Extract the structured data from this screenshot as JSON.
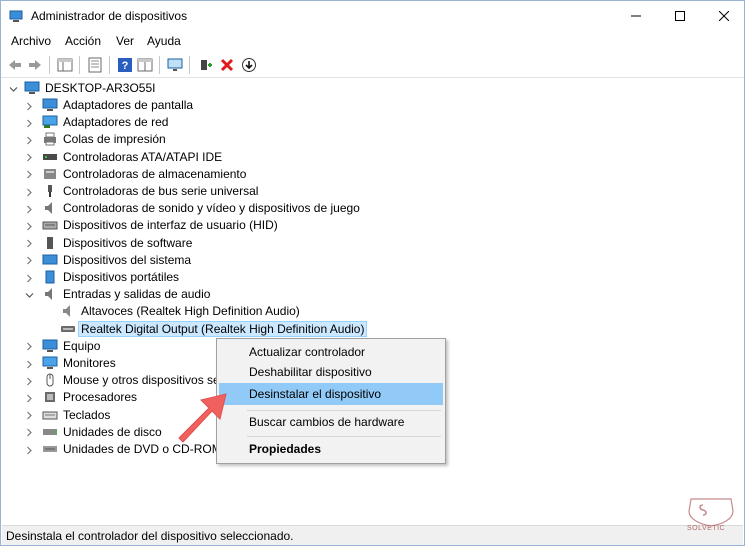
{
  "window": {
    "title": "Administrador de dispositivos"
  },
  "menu": [
    "Archivo",
    "Acción",
    "Ver",
    "Ayuda"
  ],
  "tree": {
    "root": "DESKTOP-AR3O55I",
    "items": [
      "Adaptadores de pantalla",
      "Adaptadores de red",
      "Colas de impresión",
      "Controladoras ATA/ATAPI IDE",
      "Controladoras de almacenamiento",
      "Controladoras de bus serie universal",
      "Controladoras de sonido y vídeo y dispositivos de juego",
      "Dispositivos de interfaz de usuario (HID)",
      "Dispositivos de software",
      "Dispositivos del sistema",
      "Dispositivos portátiles",
      "Entradas y salidas de audio",
      "Altavoces (Realtek High Definition Audio)",
      "Realtek Digital Output (Realtek High Definition Audio)",
      "Equipo",
      "Monitores",
      "Mouse y otros dispositivos señ",
      "Procesadores",
      "Teclados",
      "Unidades de disco",
      "Unidades de DVD o CD-ROM"
    ]
  },
  "context_menu": {
    "items": [
      "Actualizar controlador",
      "Deshabilitar dispositivo",
      "Desinstalar el dispositivo",
      "Buscar cambios de hardware",
      "Propiedades"
    ]
  },
  "status": "Desinstala el controlador del dispositivo seleccionado.",
  "watermark": "SOLVETIC",
  "colors": {
    "selection": "#cce8ff",
    "menu_highlight": "#91c9f7",
    "arrow": "#f0605f",
    "delete_icon": "#e01b1b",
    "add_icon": "#2f9a2f"
  }
}
